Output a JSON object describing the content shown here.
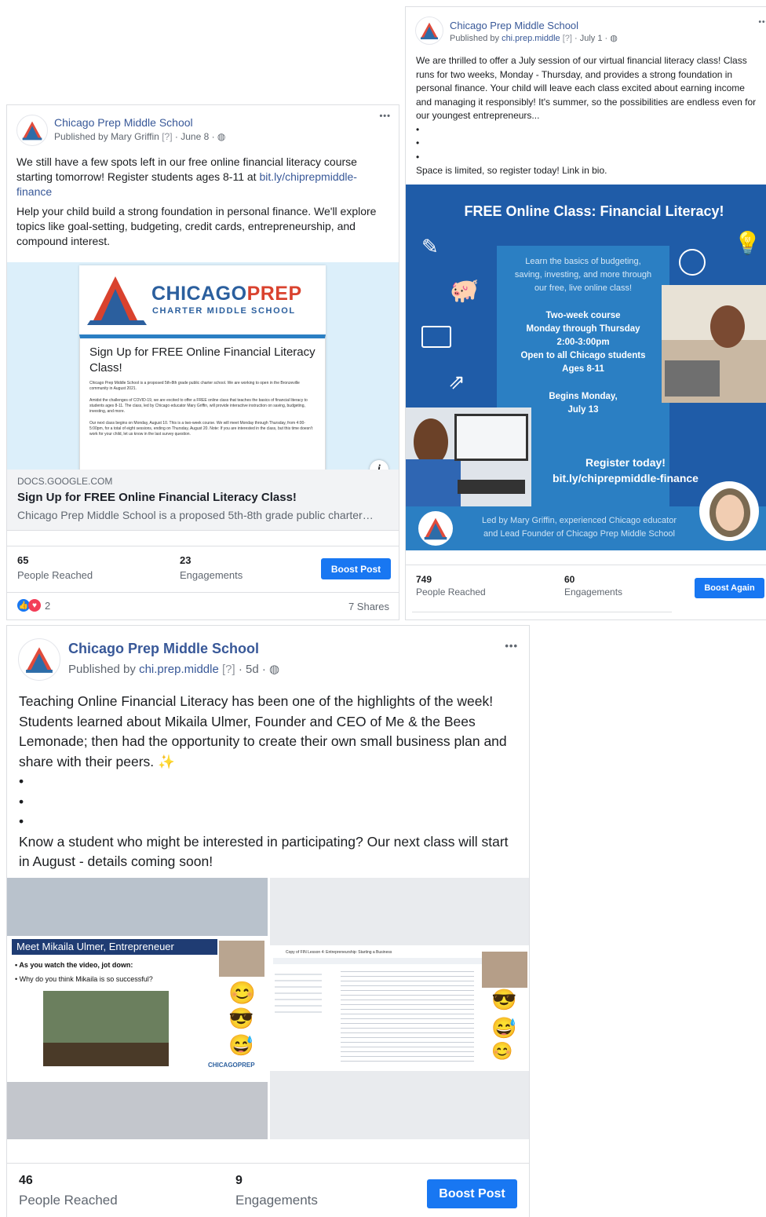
{
  "post1": {
    "page_name": "Chicago Prep Middle School",
    "published_by_prefix": "Published by",
    "published_by": "Mary Griffin",
    "help": "[?]",
    "date": "June 8",
    "menu": "•••",
    "text_1": "We still have a few spots left in our free online financial literacy course starting tomorrow! Register students ages 8-11 at",
    "text_link": "bit.ly/chiprepmiddle-finance",
    "text_2": "Help your child build a strong foundation in personal finance. We'll explore topics like goal-setting, budgeting, credit cards, entrepreneurship, and compound interest.",
    "preview": {
      "logo_chicago": "CHICAGO",
      "logo_prep": "PREP",
      "logo_sub": "CHARTER MIDDLE SCHOOL",
      "form_title": "Sign Up for FREE Online Financial Literacy Class!",
      "form_p1": "Chicago Prep Middle School is a proposed 5th-8th grade public charter school. We are working to open in the Bronzeville community in August 2021.",
      "form_p2": "Amidst the challenges of COVID-19, we are excited to offer a FREE online class that teaches the basics of financial literacy to students ages 8-11. The class, led by Chicago educator Mary Griffin, will provide interactive instruction on saving, budgeting, investing, and more.",
      "form_p3": "Our next class begins on Monday, August 10. This is a two-week course. We will meet Monday through Thursday, from 4:00-5:00pm, for a total of eight sessions, ending on Thursday, August 20. Note: If you are interested in the class, but this time doesn't work for your child, let us know in the last survey question.",
      "info": "i"
    },
    "link_domain": "DOCS.GOOGLE.COM",
    "link_title": "Sign Up for FREE Online Financial Literacy Class!",
    "link_desc": "Chicago Prep Middle School is a proposed 5th-8th grade public charter…",
    "reached_num": "65",
    "reached_label": "People Reached",
    "engagements_num": "23",
    "engagements_label": "Engagements",
    "boost_label": "Boost Post",
    "reactions_count": "2",
    "shares": "7 Shares"
  },
  "post2": {
    "page_name": "Chicago Prep Middle School",
    "published_by_prefix": "Published by",
    "published_by": "chi.prep.middle",
    "help": "[?]",
    "date": "July 1",
    "menu": "•••",
    "text_1": "We are thrilled to offer a July session of our virtual financial literacy class! Class runs for two weeks, Monday - Thursday, and provides a strong foundation in personal finance. Your child will leave each class excited about earning income and managing it responsibly! It's summer, so the possibilities are endless even for our youngest entrepreneurs...",
    "bullet": "•",
    "text_2": "Space is limited, so register today! Link in bio.",
    "flyer": {
      "title": "FREE Online Class: Financial Literacy!",
      "box_1": "Learn the basics of budgeting, saving, investing, and more through our free, live online class!",
      "box_2a": "Two-week course",
      "box_2b": "Monday through Thursday",
      "box_2c": "2:00-3:00pm",
      "box_2d": "Open to all Chicago students",
      "box_2e": "Ages 8-11",
      "box_3a": "Begins Monday,",
      "box_3b": "July 13",
      "register_1": "Register today!",
      "register_2": "bit.ly/chiprepmiddle-finance",
      "footer_1": "Led by Mary Griffin, experienced Chicago educator",
      "footer_2": "and Lead Founder of Chicago Prep Middle School"
    },
    "reached_num": "749",
    "reached_label": "People Reached",
    "engagements_num": "60",
    "engagements_label": "Engagements",
    "boost_label": "Boost Again"
  },
  "post3": {
    "page_name": "Chicago Prep Middle School",
    "published_by_prefix": "Published by",
    "published_by": "chi.prep.middle",
    "help": "[?]",
    "date": "5d",
    "menu": "•••",
    "text_1": "Teaching Online Financial Literacy has been one of the highlights of the week! Students learned about Mikaila Ulmer, Founder and CEO of Me & the Bees Lemonade; then had the opportunity to create their own small business plan and share with their peers.",
    "bullet": "•",
    "text_2": "Know a student who might be interested in participating? Our next class will start in August - details coming soon!",
    "slide_title": "Meet Mikaila Ulmer, Entrepreneuer",
    "slide_b1": "As you watch the video, jot down:",
    "slide_b2": "Why do you think Mikaila is so successful?",
    "slide_logo": "CHICAGOPREP",
    "doc_title": "Copy of FIN Lesson 4: Entrepreneurship: Starting a Business",
    "reached_num": "46",
    "reached_label": "People Reached",
    "engagements_num": "9",
    "engagements_label": "Engagements",
    "boost_label": "Boost Post"
  },
  "colors": {
    "link": "#385898",
    "boost": "#1877f2",
    "flyer_blue": "#1f5ca8",
    "flyer_light": "#2b7fc3"
  }
}
